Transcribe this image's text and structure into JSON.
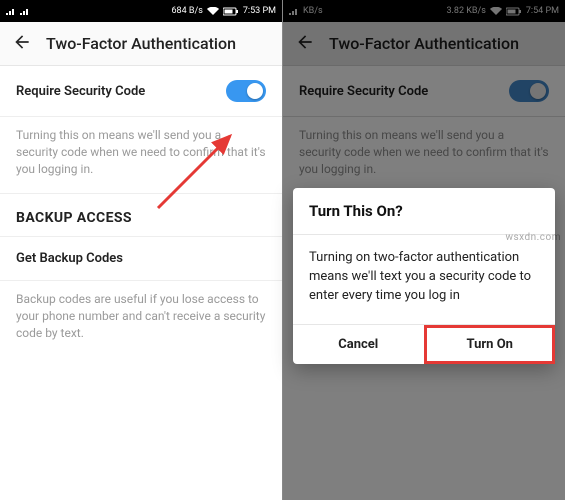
{
  "left": {
    "statusbar": {
      "net": "684 B/s",
      "time": "7:53 PM",
      "batt": "73"
    },
    "header": {
      "title": "Two-Factor Authentication"
    },
    "toggle_row": {
      "label": "Require Security Code"
    },
    "toggle_desc": "Turning this on means we'll send you a security code when we need to confirm that it's you logging in.",
    "backup_title": "BACKUP ACCESS",
    "backup_link": "Get Backup Codes",
    "backup_desc": "Backup codes are useful if you lose access to your phone number and can't receive a security code by text."
  },
  "right": {
    "statusbar": {
      "net": "3.82 KB/s",
      "time": "7:54 PM",
      "batt": "73"
    },
    "header": {
      "title": "Two-Factor Authentication"
    },
    "toggle_row": {
      "label": "Require Security Code"
    },
    "toggle_desc": "Turning this on means we'll send you a security code when we need to confirm that it's you logging in.",
    "dialog": {
      "title": "Turn This On?",
      "body": "Turning on two-factor authentication means we'll text you a security code to enter every time you log in",
      "cancel": "Cancel",
      "confirm": "Turn On"
    }
  },
  "watermark": "wsxdn.com",
  "statusbar_unit": "KB/s"
}
